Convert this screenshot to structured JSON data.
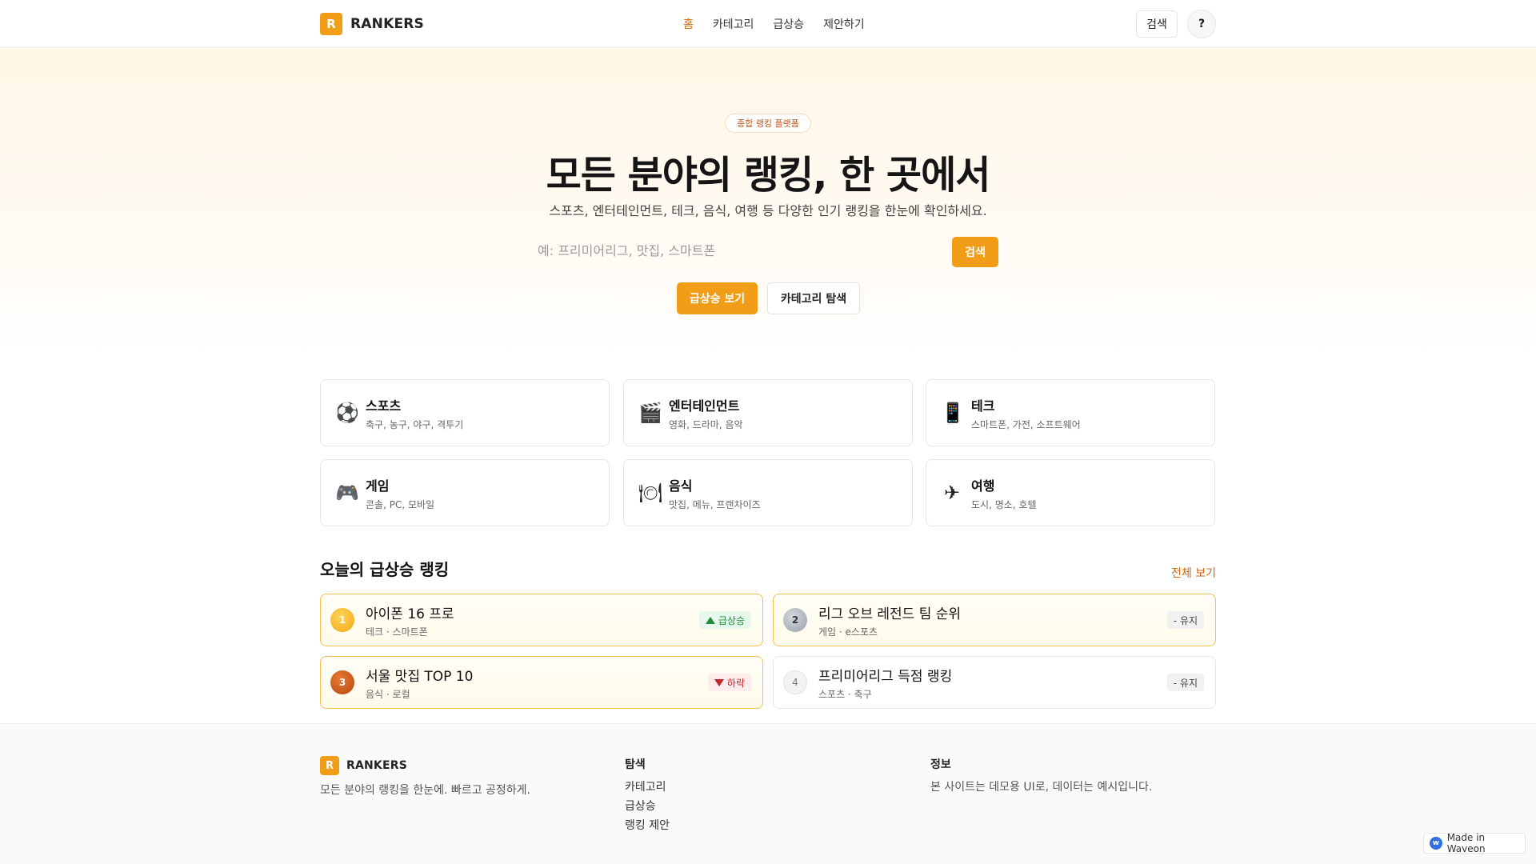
{
  "header": {
    "logo_mark": "R",
    "logo_text": "RANKERS",
    "nav": [
      "홈",
      "카테고리",
      "급상승",
      "제안하기"
    ],
    "search_label": "검색",
    "help_label": "?"
  },
  "hero": {
    "badge": "종합 랭킹 플랫폼",
    "title": "모든 분야의 랭킹, 한 곳에서",
    "subtitle": "스포츠, 엔터테인먼트, 테크, 음식, 여행 등 다양한 인기 랭킹을 한눈에 확인하세요.",
    "search_placeholder": "예: 프리미어리그, 맛집, 스마트폰",
    "search_button": "검색",
    "cta_primary": "급상승 보기",
    "cta_secondary": "카테고리 탐색"
  },
  "categories": [
    {
      "icon": "soccer-ball-icon",
      "glyph": "⚽",
      "title": "스포츠",
      "desc": "축구, 농구, 야구, 격투기"
    },
    {
      "icon": "movie-icon",
      "glyph": "🎬",
      "title": "엔터테인먼트",
      "desc": "영화, 드라마, 음악"
    },
    {
      "icon": "phone-icon",
      "glyph": "📱",
      "title": "테크",
      "desc": "스마트폰, 가전, 소프트웨어"
    },
    {
      "icon": "gamepad-icon",
      "glyph": "🎮",
      "title": "게임",
      "desc": "콘솔, PC, 모바일"
    },
    {
      "icon": "food-icon",
      "glyph": "🍽",
      "title": "음식",
      "desc": "맛집, 메뉴, 프랜차이즈"
    },
    {
      "icon": "airplane-icon",
      "glyph": "✈",
      "title": "여행",
      "desc": "도시, 명소, 호텔"
    }
  ],
  "rising": {
    "title": "오늘의 급상승 랭킹",
    "see_all": "전체 보기",
    "items": [
      {
        "rank": "1",
        "title": "아이폰 16 프로",
        "meta": "테크 · 스마트폰",
        "badge": "급상승",
        "trend": "up"
      },
      {
        "rank": "2",
        "title": "리그 오브 레전드 팀 순위",
        "meta": "게임 · e스포츠",
        "badge": "- 유지",
        "trend": "keep"
      },
      {
        "rank": "3",
        "title": "서울 맛집 TOP 10",
        "meta": "음식 · 로컬",
        "badge": "하락",
        "trend": "down"
      },
      {
        "rank": "4",
        "title": "프리미어리그 득점 랭킹",
        "meta": "스포츠 · 축구",
        "badge": "- 유지",
        "trend": "keep"
      }
    ]
  },
  "footer": {
    "logo_mark": "R",
    "logo_text": "RANKERS",
    "tagline": "모든 분야의 랭킹을 한눈에. 빠르고 공정하게.",
    "explore_title": "탐색",
    "explore_links": [
      "카테고리",
      "급상승",
      "랭킹 제안"
    ],
    "info_title": "정보",
    "info_text": "본 사이트는 데모용 UI로, 데이터는 예시입니다."
  },
  "badge_waveon": "Made in Waveon",
  "colors": {
    "accent": "#f29d17",
    "active_nav": "#d3660a",
    "up": "#1f8a3b",
    "down": "#c0282d"
  }
}
